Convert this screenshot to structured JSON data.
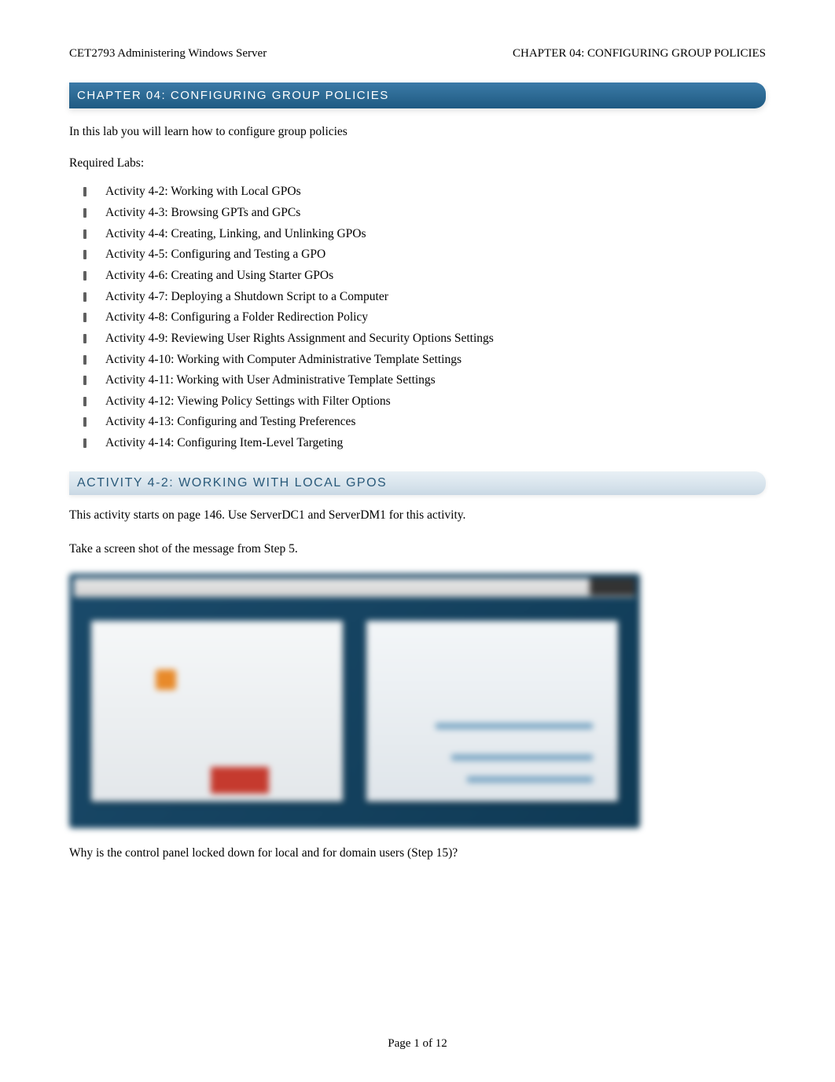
{
  "header": {
    "left": "CET2793 Administering Windows Server",
    "right": "CHAPTER 04: CONFIGURING GROUP POLICIES"
  },
  "chapter_heading": "CHAPTER 04: CONFIGURING GROUP POLICIES",
  "intro": "In this lab you will learn how to configure group policies",
  "required_labs_label": "Required Labs:",
  "labs": [
    "Activity 4-2: Working with Local GPOs",
    "Activity 4-3: Browsing GPTs and GPCs",
    "Activity 4-4: Creating, Linking, and Unlinking GPOs",
    "Activity 4-5: Configuring and Testing a GPO",
    "Activity 4-6: Creating and Using Starter GPOs",
    "Activity 4-7: Deploying a Shutdown Script to a Computer",
    "Activity 4-8: Configuring a Folder Redirection Policy",
    "Activity 4-9: Reviewing User Rights Assignment and Security Options Settings",
    "Activity 4-10: Working with Computer Administrative Template Settings",
    "Activity 4-11: Working with User Administrative Template Settings",
    "Activity 4-12: Viewing Policy Settings with Filter Options",
    "Activity 4-13: Configuring and Testing Preferences",
    "Activity 4-14: Configuring Item-Level Targeting"
  ],
  "activity_heading": "ACTIVITY 4-2: WORKING WITH LOCAL GPOS",
  "activity_intro": "This activity starts on page 146. Use ServerDC1 and ServerDM1 for this activity.",
  "screenshot_instruction": "Take a screen shot of the message from Step 5.",
  "question": "Why is the control panel locked down for local and for domain users (Step 15)?",
  "footer": "Page 1 of 12"
}
